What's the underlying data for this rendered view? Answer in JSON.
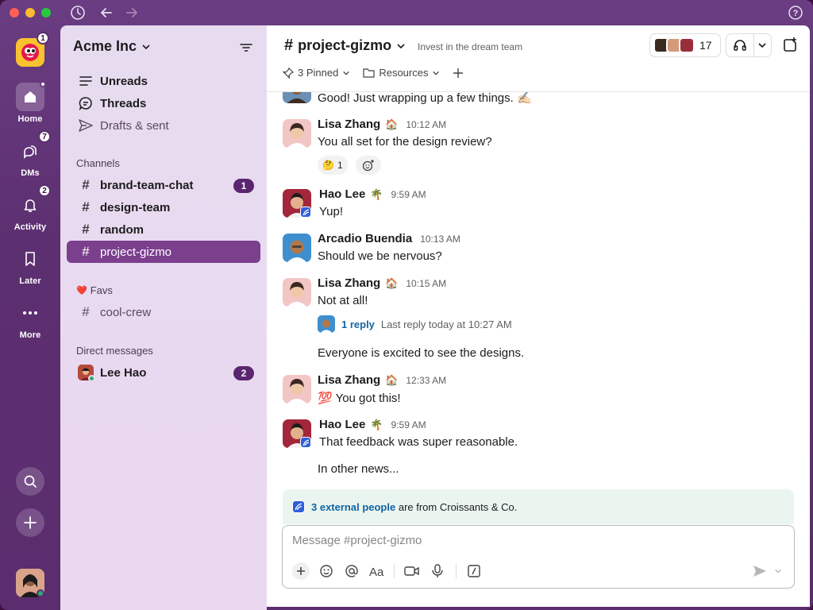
{
  "titlebar": {
    "icons": [
      "history-icon",
      "back-arrow-icon",
      "forward-arrow-icon",
      "help-icon"
    ]
  },
  "rail": {
    "workspace_badge": "1",
    "items": [
      {
        "label": "Home",
        "icon": "home-icon",
        "badge": ""
      },
      {
        "label": "DMs",
        "icon": "dms-icon",
        "badge": "7"
      },
      {
        "label": "Activity",
        "icon": "bell-icon",
        "badge": "2"
      },
      {
        "label": "Later",
        "icon": "bookmark-icon",
        "badge": ""
      },
      {
        "label": "More",
        "icon": "more-icon",
        "badge": ""
      }
    ]
  },
  "sidebar": {
    "workspace_name": "Acme Inc",
    "nav": [
      {
        "label": "Unreads",
        "icon": "unreads-icon"
      },
      {
        "label": "Threads",
        "icon": "threads-icon"
      },
      {
        "label": "Drafts & sent",
        "icon": "send-icon"
      }
    ],
    "channels_label": "Channels",
    "channels": [
      {
        "name": "brand-team-chat",
        "badge": "1"
      },
      {
        "name": "design-team",
        "badge": ""
      },
      {
        "name": "random",
        "badge": ""
      },
      {
        "name": "project-gizmo",
        "badge": ""
      }
    ],
    "favs_emoji": "❤️",
    "favs_label": "Favs",
    "favs": [
      {
        "name": "cool-crew"
      }
    ],
    "dm_label": "Direct messages",
    "dms": [
      {
        "name": "Lee Hao",
        "badge": "2"
      }
    ]
  },
  "channel": {
    "hash": "#",
    "name": "project-gizmo",
    "topic": "Invest in the dream team",
    "member_count": "17",
    "pinned_label": "3 Pinned",
    "resources_label": "Resources"
  },
  "messages": [
    {
      "text": "Good! Just wrapping up a few things. ✍🏻"
    },
    {
      "name": "Lisa Zhang",
      "status": "🏠",
      "time": "10:12 AM",
      "text": "You all set for the design review?",
      "reaction_emoji": "🤔",
      "reaction_count": "1"
    },
    {
      "name": "Hao Lee",
      "status": "🌴",
      "time": "9:59 AM",
      "text": "Yup!"
    },
    {
      "name": "Arcadio Buendia",
      "status": "",
      "time": "10:13 AM",
      "text": "Should we be nervous?"
    },
    {
      "name": "Lisa Zhang",
      "status": "🏠",
      "time": "10:15 AM",
      "text": "Not at all!",
      "thread_replies": "1 reply",
      "thread_meta": "Last reply today at 10:27 AM"
    },
    {
      "text": "Everyone is excited to see the designs."
    },
    {
      "name": "Lisa Zhang",
      "status": "🏠",
      "time": "12:33 AM",
      "text": "💯 You got this!"
    },
    {
      "name": "Hao Lee",
      "status": "🌴",
      "time": "9:59 AM",
      "text": "That feedback was super reasonable."
    },
    {
      "text": "In other news..."
    }
  ],
  "banner": {
    "link": "3 external people",
    "rest": "are from Croissants & Co."
  },
  "composer": {
    "placeholder": "Message #project-gizmo",
    "tools": [
      "plus-icon",
      "emoji-icon",
      "mention-icon",
      "format-icon",
      "video-icon",
      "mic-icon",
      "slash-icon",
      "send-icon",
      "chevron-down-icon"
    ]
  },
  "colors": {
    "aubergine": "#5c2f70",
    "active_channel": "#7b3f8e",
    "link": "#1264a3"
  }
}
